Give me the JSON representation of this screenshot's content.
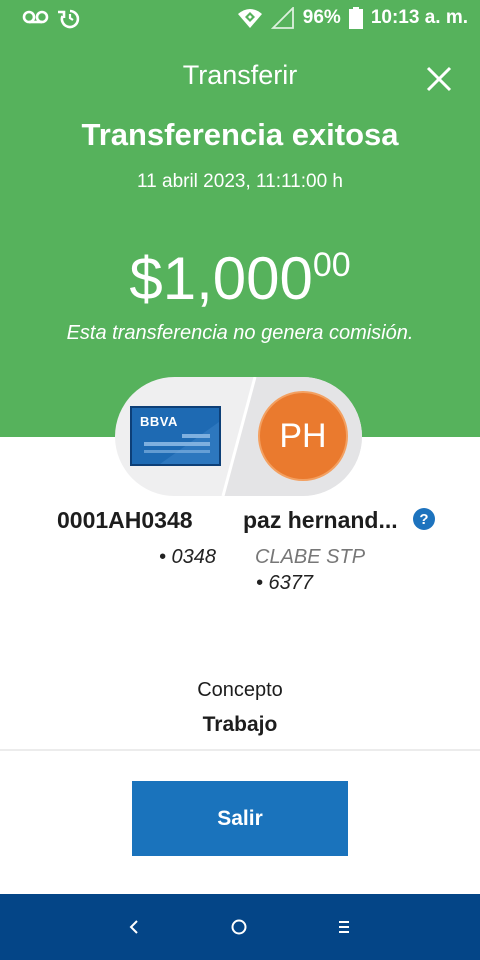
{
  "status_bar": {
    "battery": "96%",
    "time": "10:13 a. m."
  },
  "header": {
    "title": "Transferir",
    "headline": "Transferencia exitosa",
    "datetime": "11 abril 2023, 11:11:00 h",
    "amount_main": "$1,000",
    "amount_cents": "00",
    "commission_note": "Esta transferencia no genera comisión."
  },
  "card": {
    "bank_logo": "BBVA",
    "avatar_initials": "PH"
  },
  "origin": {
    "account": "0001AH0348",
    "last_digits": "• 0348"
  },
  "destination": {
    "name": "paz hernand...",
    "clabe_label": "CLABE STP",
    "last_digits": "• 6377"
  },
  "concept": {
    "label": "Concepto",
    "value": "Trabajo"
  },
  "exit_button": {
    "label": "Salir"
  },
  "icons": [
    "voicemail-icon",
    "sync-icon",
    "wifi-icon",
    "signal-icon",
    "battery-icon",
    "close-icon",
    "help-icon",
    "back-icon",
    "home-icon",
    "menu-icon"
  ],
  "colors": {
    "header_green": "#56b25c",
    "button_blue": "#1a73bc",
    "nav_blue": "#044587",
    "avatar_orange": "#ea7a2e"
  }
}
